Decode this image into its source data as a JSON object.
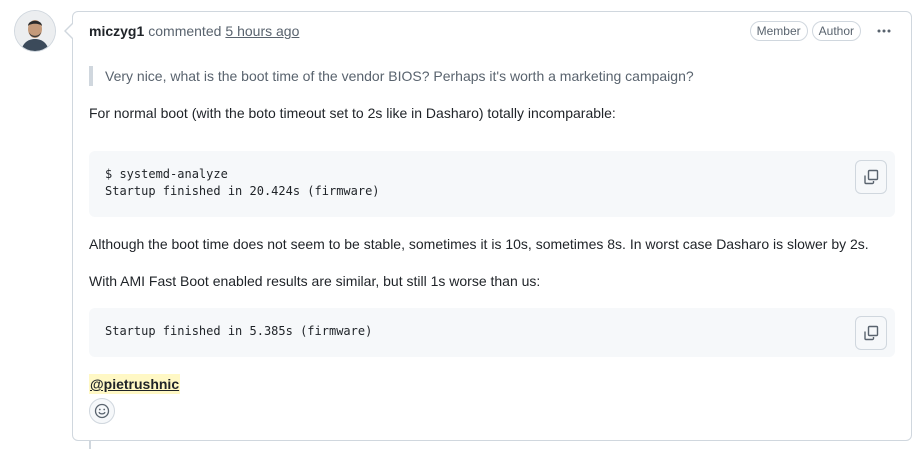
{
  "comment": {
    "author": "miczyg1",
    "verb": "commented",
    "time": "5 hours ago",
    "badges": [
      "Member",
      "Author"
    ],
    "more_icon": "kebab-horizontal-icon",
    "avatar_icon": "user-avatar"
  },
  "body": {
    "quote": "Very nice, what is the boot time of the vendor BIOS? Perhaps it's worth a marketing campaign?",
    "p1": "For normal boot (with the boto timeout set to 2s like in Dasharo) totally incomparable:",
    "code1": [
      "$ systemd-analyze",
      "Startup finished in 20.424s (firmware)"
    ],
    "p2": "Although the boot time does not seem to be stable, sometimes it is 10s, sometimes 8s. In worst case Dasharo is slower by 2s.",
    "p3": "With AMI Fast Boot enabled results are similar, but still 1s worse than us:",
    "code2": [
      "Startup finished in 5.385s (firmware)"
    ],
    "mention": "@pietrushnic",
    "copy_icon": "copy-icon",
    "reaction_icon": "smiley-icon"
  },
  "colors": {
    "border": "#d0d7de",
    "muted_text": "#59636e",
    "code_bg": "#f6f8fa",
    "mention_bg": "#fff8c5"
  }
}
